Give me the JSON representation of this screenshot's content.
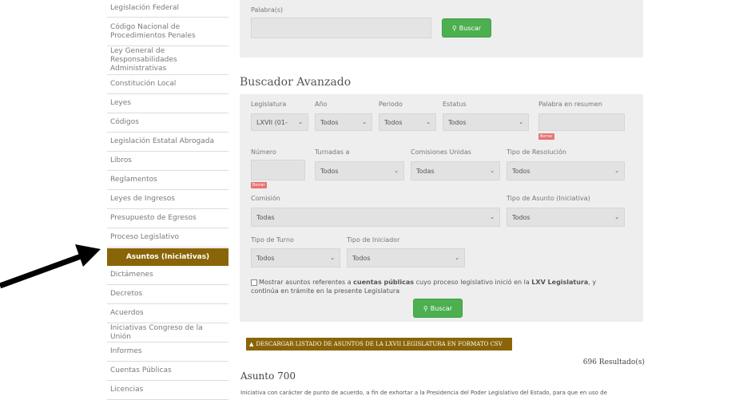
{
  "sidebar": {
    "items": [
      {
        "label": "Legislación Federal"
      },
      {
        "label": "Código Nacional de Procedimientos Penales"
      },
      {
        "label": "Ley General de Responsabilidades Administrativas"
      },
      {
        "label": "Constitución Local"
      },
      {
        "label": "Leyes"
      },
      {
        "label": "Códigos"
      },
      {
        "label": "Legislación Estatal Abrogada"
      },
      {
        "label": "Libros"
      },
      {
        "label": "Reglamentos"
      },
      {
        "label": "Leyes de Ingresos"
      },
      {
        "label": "Presupuesto de Egresos"
      },
      {
        "label": "Proceso Legislativo"
      },
      {
        "label": "Asuntos (Iniciativas)"
      },
      {
        "label": "Dictámenes"
      },
      {
        "label": "Decretos"
      },
      {
        "label": "Acuerdos"
      },
      {
        "label": "Iniciativas Congreso de la Unión"
      },
      {
        "label": "Informes"
      },
      {
        "label": "Cuentas Públicas"
      },
      {
        "label": "Licencias"
      }
    ]
  },
  "simple_search": {
    "label": "Palabra(s)",
    "input_value": "",
    "button_label": "Buscar"
  },
  "advanced": {
    "title": "Buscador Avanzado",
    "legislatura": {
      "label": "Legislatura",
      "value": "LXVII (01-"
    },
    "anio": {
      "label": "Año",
      "value": "Todos"
    },
    "periodo": {
      "label": "Periodo",
      "value": "Todos"
    },
    "estatus": {
      "label": "Estatus",
      "value": "Todos"
    },
    "palabra_resumen": {
      "label": "Palabra en resumen",
      "value": ""
    },
    "borrar_label": "Borrar",
    "numero": {
      "label": "Número",
      "value": ""
    },
    "turnadas": {
      "label": "Turnadas a",
      "value": "Todos"
    },
    "comisiones_unidas": {
      "label": "Comisiones Unidas",
      "value": "Todas"
    },
    "tipo_resolucion": {
      "label": "Tipo de Resolución",
      "value": "Todos"
    },
    "comision": {
      "label": "Comisión",
      "value": "Todas"
    },
    "tipo_asunto": {
      "label": "Tipo de Asunto (Iniciativa)",
      "value": "Todos"
    },
    "tipo_turno": {
      "label": "Tipo de Turno",
      "value": "Todos"
    },
    "tipo_iniciador": {
      "label": "Tipo de Iniciador",
      "value": "Todos"
    },
    "checkbox": {
      "text_1": "Mostrar asuntos referentes a ",
      "bold_1": "cuentas públicas",
      "text_2": " cuyo proceso legislativo inició en la ",
      "bold_2": "LXV Legislatura",
      "text_3": ", y continúa en trámite en la presente Legislatura"
    },
    "button_label": "Buscar"
  },
  "download_label": "DESCARGAR LISTADO DE ASUNTOS DE LA LXVII LEGISLATURA EN FORMATO CSV",
  "results_count": "696 Resultado(s)",
  "asunto": {
    "title": "Asunto 700",
    "description": "Iniciativa con carácter de punto de acuerdo, a fin de exhortar a la Presidencia del Poder Legislativo del Estado, para que en uso de"
  },
  "colors": {
    "accent": "#8a6508",
    "button": "#4caf50",
    "panel": "#eeeeee"
  }
}
